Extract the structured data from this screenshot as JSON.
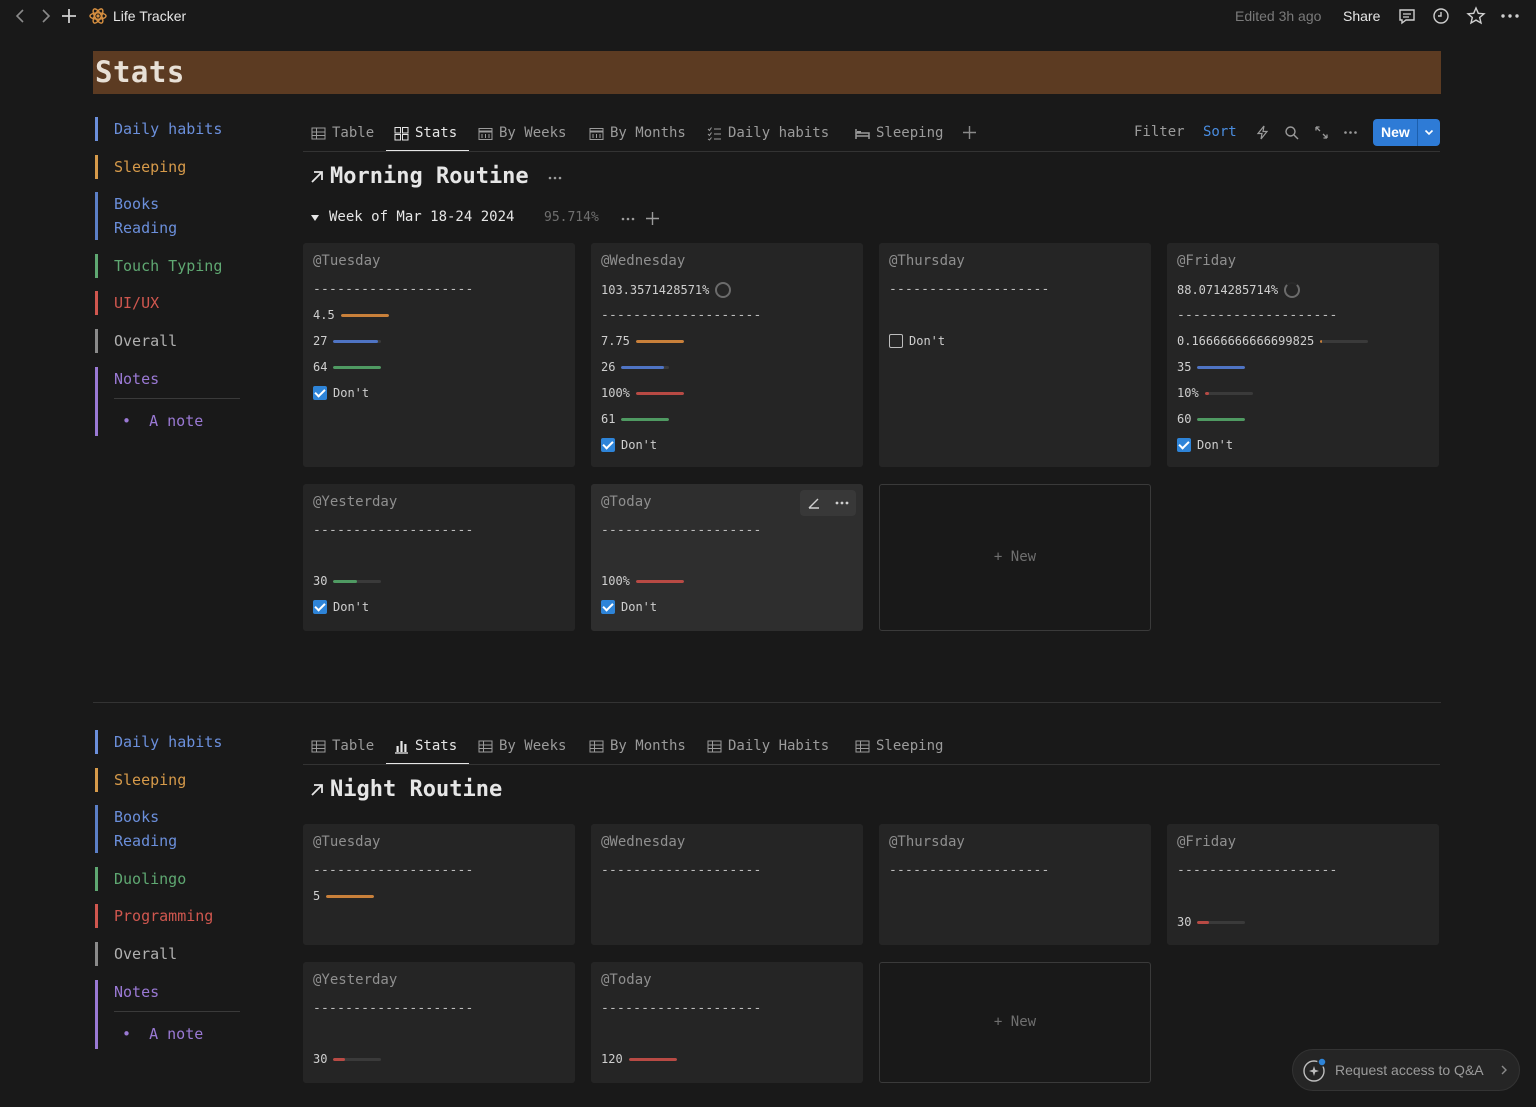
{
  "topbar": {
    "page_name": "Life Tracker",
    "edited": "Edited 3h ago",
    "share": "Share"
  },
  "banner": {
    "title": "Stats"
  },
  "sidebar_top": [
    {
      "label": "Daily habits",
      "color": "#6b8fdb"
    },
    {
      "label": "Sleeping",
      "color": "#d69a4a"
    },
    {
      "label": "Books\nReading",
      "color": "#5b7fc7"
    },
    {
      "label": "Touch Typing",
      "color": "#5fa872"
    },
    {
      "label": "UI/UX",
      "color": "#d0574f"
    },
    {
      "label": "Overall",
      "color": "#b0b0b0"
    },
    {
      "label": "Notes",
      "color": "#9a79d4"
    }
  ],
  "sidebar_bottom": [
    {
      "label": "Daily habits",
      "color": "#6b8fdb"
    },
    {
      "label": "Sleeping",
      "color": "#d69a4a"
    },
    {
      "label": "Books\nReading",
      "color": "#5b7fc7"
    },
    {
      "label": "Duolingo",
      "color": "#5fa872"
    },
    {
      "label": "Programming",
      "color": "#d0574f"
    },
    {
      "label": "Overall",
      "color": "#b0b0b0"
    },
    {
      "label": "Notes",
      "color": "#9a79d4"
    }
  ],
  "note_item": "A note",
  "tabs_top": [
    "Table",
    "Stats",
    "By Weeks",
    "By Months",
    "Daily habits",
    "Sleeping"
  ],
  "tabs_bottom": [
    "Table",
    "Stats",
    "By Weeks",
    "By Months",
    "Daily Habits",
    "Sleeping"
  ],
  "toolbar": {
    "filter": "Filter",
    "sort": "Sort",
    "new": "New"
  },
  "section1": {
    "title": "Morning Routine",
    "group_label": "Week of Mar 18-24 2024",
    "group_pct": "95.714%"
  },
  "section2": {
    "title": "Night Routine"
  },
  "dash": "--------------------",
  "dont": "Don't",
  "new_card": "New",
  "cards1": {
    "tuesday": {
      "title": "@Tuesday",
      "rows": [
        "4.5",
        "27",
        "64"
      ]
    },
    "wednesday": {
      "title": "@Wednesday",
      "pct": "103.3571428571%",
      "rows": [
        "7.75",
        "26",
        "100%",
        "61"
      ]
    },
    "thursday": {
      "title": "@Thursday"
    },
    "friday": {
      "title": "@Friday",
      "pct": "88.0714285714%",
      "rows": [
        "0.16666666666699825",
        "35",
        "10%",
        "60"
      ]
    },
    "yesterday": {
      "title": "@Yesterday",
      "rows": [
        "30"
      ]
    },
    "today": {
      "title": "@Today",
      "rows": [
        "100%"
      ]
    }
  },
  "cards2": {
    "tuesday": {
      "title": "@Tuesday",
      "rows": [
        "5"
      ]
    },
    "wednesday": {
      "title": "@Wednesday"
    },
    "thursday": {
      "title": "@Thursday"
    },
    "friday": {
      "title": "@Friday",
      "rows": [
        "30"
      ]
    },
    "yesterday": {
      "title": "@Yesterday",
      "rows": [
        "30"
      ]
    },
    "today": {
      "title": "@Today",
      "rows": [
        "120"
      ]
    }
  },
  "qa_button": "Request access to Q&A",
  "colors": {
    "orange": "#c9803a",
    "blue": "#4f74c4",
    "red": "#b84a44",
    "green": "#4f9a62",
    "accent": "#2e7bd6"
  }
}
